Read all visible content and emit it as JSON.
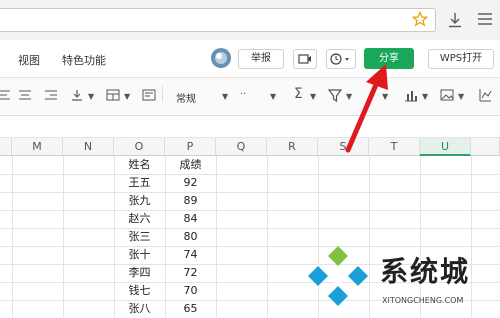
{
  "ribbon": {
    "menu_view": "视图",
    "menu_features": "特色功能",
    "report_label": "举报",
    "share_label": "分享",
    "wps_open_label": "WPS打开"
  },
  "toolbar": {
    "number_format": "常规"
  },
  "sheet": {
    "columns": [
      "M",
      "N",
      "O",
      "P",
      "Q",
      "R",
      "S",
      "T",
      "U"
    ],
    "selected_column": "U",
    "header_row": {
      "name": "姓名",
      "score": "成绩"
    },
    "rows": [
      {
        "name": "王五",
        "score": "92"
      },
      {
        "name": "张九",
        "score": "89"
      },
      {
        "name": "赵六",
        "score": "84"
      },
      {
        "name": "张三",
        "score": "80"
      },
      {
        "name": "张十",
        "score": "74"
      },
      {
        "name": "李四",
        "score": "72"
      },
      {
        "name": "钱七",
        "score": "70"
      },
      {
        "name": "张八",
        "score": "65"
      }
    ]
  },
  "watermark": {
    "title": "系统城",
    "url": "XITONGCHENG.COM"
  },
  "colors": {
    "share_green": "#1aa75a",
    "arrow_red": "#e0191e",
    "selected_col": "#2fa360"
  }
}
